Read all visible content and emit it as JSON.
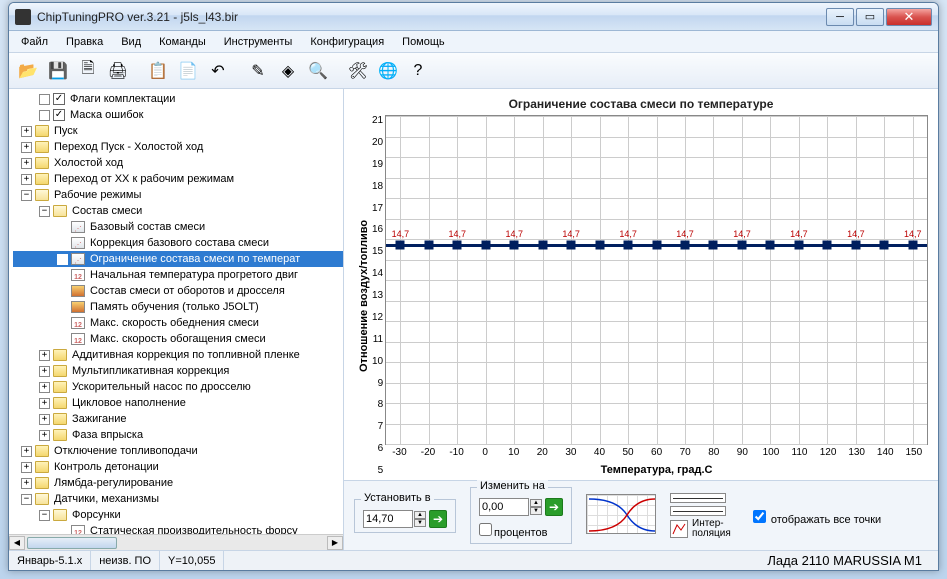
{
  "window": {
    "title": "ChipTuningPRO ver.3.21 - j5ls_l43.bir"
  },
  "menu": [
    "Файл",
    "Правка",
    "Вид",
    "Команды",
    "Инструменты",
    "Конфигурация",
    "Помощь"
  ],
  "toolbar_icons": [
    "open-icon",
    "save-icon",
    "save-as-icon",
    "print-icon",
    "tsep",
    "copy-icon",
    "paste-icon",
    "undo-icon",
    "tsep",
    "edit-icon",
    "info-icon",
    "search-icon",
    "tsep",
    "tune-icon",
    "globe-icon",
    "help-icon"
  ],
  "tree": [
    {
      "d": 1,
      "t": "check",
      "label": "Флаги комплектации",
      "sel": false
    },
    {
      "d": 1,
      "t": "check",
      "label": "Маска ошибок"
    },
    {
      "d": 0,
      "t": "plus",
      "i": "folder",
      "label": "Пуск"
    },
    {
      "d": 0,
      "t": "plus",
      "i": "folder",
      "label": "Переход Пуск - Холостой ход"
    },
    {
      "d": 0,
      "t": "plus",
      "i": "folder",
      "label": "Холостой ход"
    },
    {
      "d": 0,
      "t": "plus",
      "i": "folder",
      "label": "Переход от ХХ к рабочим режимам"
    },
    {
      "d": 0,
      "t": "minus",
      "i": "folder open",
      "label": "Рабочие режимы"
    },
    {
      "d": 1,
      "t": "minus",
      "i": "folder open",
      "label": "Состав смеси"
    },
    {
      "d": 2,
      "t": "blank",
      "i": "leaf-2d",
      "label": "Базовый состав смеси"
    },
    {
      "d": 2,
      "t": "blank",
      "i": "leaf-2d",
      "label": "Коррекция базового состава смеси"
    },
    {
      "d": 2,
      "t": "blank",
      "i": "leaf-2d",
      "label": "Ограничение состава смеси по температ",
      "sel": true
    },
    {
      "d": 2,
      "t": "blank",
      "i": "leaf-12",
      "label": "Начальная температура прогретого двиг"
    },
    {
      "d": 2,
      "t": "blank",
      "i": "leaf-3d",
      "label": "Состав смеси от оборотов и дросселя"
    },
    {
      "d": 2,
      "t": "blank",
      "i": "leaf-3d",
      "label": "Память обучения (только J5OLT)"
    },
    {
      "d": 2,
      "t": "blank",
      "i": "leaf-12",
      "label": "Макс. скорость обеднения смеси"
    },
    {
      "d": 2,
      "t": "blank",
      "i": "leaf-12",
      "label": "Макс. скорость обогащения смеси"
    },
    {
      "d": 1,
      "t": "plus",
      "i": "folder",
      "label": "Аддитивная коррекция по топливной пленке"
    },
    {
      "d": 1,
      "t": "plus",
      "i": "folder",
      "label": "Мультипликативная коррекция"
    },
    {
      "d": 1,
      "t": "plus",
      "i": "folder",
      "label": "Ускорительный насос по дросселю"
    },
    {
      "d": 1,
      "t": "plus",
      "i": "folder",
      "label": "Цикловое наполнение"
    },
    {
      "d": 1,
      "t": "plus",
      "i": "folder",
      "label": "Зажигание"
    },
    {
      "d": 1,
      "t": "plus",
      "i": "folder",
      "label": "Фаза впрыска"
    },
    {
      "d": 0,
      "t": "plus",
      "i": "folder",
      "label": "Отключение топливоподачи"
    },
    {
      "d": 0,
      "t": "plus",
      "i": "folder",
      "label": "Контроль детонации"
    },
    {
      "d": 0,
      "t": "plus",
      "i": "folder",
      "label": "Лямбда-регулирование"
    },
    {
      "d": 0,
      "t": "minus",
      "i": "folder open",
      "label": "Датчики, механизмы"
    },
    {
      "d": 1,
      "t": "minus",
      "i": "folder open",
      "label": "Форсунки"
    },
    {
      "d": 2,
      "t": "blank",
      "i": "leaf-12",
      "label": "Статическая производительность форсу"
    }
  ],
  "chart_data": {
    "type": "line",
    "title": "Ограничение состава смеси по температуре",
    "xlabel": "Температура, град.C",
    "ylabel": "Отношение воздух/топливо",
    "x": [
      -30,
      -20,
      -10,
      0,
      10,
      20,
      30,
      40,
      50,
      60,
      70,
      80,
      90,
      100,
      110,
      120,
      130,
      140,
      150
    ],
    "values": [
      14.7,
      14.7,
      14.7,
      14.7,
      14.7,
      14.7,
      14.7,
      14.7,
      14.7,
      14.7,
      14.7,
      14.7,
      14.7,
      14.7,
      14.7,
      14.7,
      14.7,
      14.7,
      14.7
    ],
    "yticks": [
      5,
      6,
      7,
      8,
      9,
      10,
      11,
      12,
      13,
      14,
      15,
      16,
      17,
      18,
      19,
      20,
      21
    ],
    "ylim": [
      5,
      21
    ]
  },
  "controls": {
    "set_label": "Установить в",
    "set_value": "14,70",
    "change_label": "Изменить на",
    "change_value": "0,00",
    "percent_label": "процентов",
    "interp_label": "Интер-\nполяция",
    "show_all_label": "отображать все точки",
    "show_all_checked": true
  },
  "status": {
    "ecu": "Январь-5.1.x",
    "flags": "неизв. ПО",
    "coord": "Y=10,055",
    "car": "Лада 2110 MARUSSIA M1"
  }
}
